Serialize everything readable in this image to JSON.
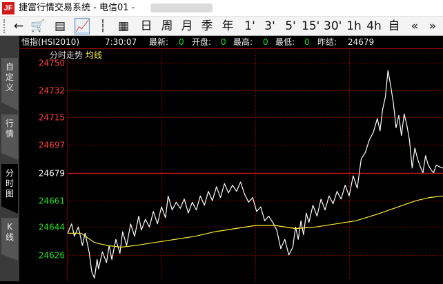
{
  "app": {
    "title": "捷富行情交易系统 - 电信01 -",
    "logo_text": "JF"
  },
  "toolbar": {
    "buttons": [
      {
        "name": "back-icon",
        "glyph": "←"
      },
      {
        "name": "cart-icon",
        "glyph": "🛒"
      },
      {
        "name": "list-icon",
        "glyph": "▤"
      },
      {
        "name": "line-chart-icon",
        "glyph": "📈",
        "active": true
      },
      {
        "name": "candlestick-icon",
        "glyph": "┆"
      },
      {
        "name": "table-icon",
        "glyph": "▦"
      }
    ],
    "periods": [
      "日",
      "周",
      "月",
      "季",
      "年",
      "1'",
      "3'",
      "5'",
      "15'",
      "30'",
      "1h",
      "4h",
      "自"
    ],
    "nav_prev": "«",
    "nav_next": "»"
  },
  "sidetabs": [
    {
      "label": "自定义",
      "active": false
    },
    {
      "label": "行情",
      "active": false
    },
    {
      "label": "分时图",
      "active": true
    },
    {
      "label": "K线",
      "active": false
    }
  ],
  "info": {
    "symbol": "恒指(HSI2010)",
    "time": "7:30:07",
    "latest_label": "最新:",
    "latest_value": "0",
    "open_label": "开盘:",
    "open_value": "0",
    "high_label": "最高:",
    "high_value": "0",
    "low_label": "最低:",
    "low_value": "0",
    "prev_close_label": "昨结:",
    "prev_close_value": "24679"
  },
  "legend": {
    "title": "分时走势",
    "avg_label": "均线"
  },
  "colors": {
    "up": "#ff3c3c",
    "down": "#22dd22",
    "neutral": "#ffffff",
    "grid": "#8b0000",
    "price_line": "#ffffff",
    "avg_line": "#ffee33"
  },
  "chart_data": {
    "type": "line",
    "title": "分时走势",
    "xlabel": "",
    "ylabel": "",
    "prev_close": 24679,
    "y_ticks": [
      24750,
      24732,
      24715,
      24697,
      24679,
      24661,
      24644,
      24626
    ],
    "ylim": [
      24609,
      24750
    ],
    "xlim": [
      0,
      560
    ],
    "grid": true,
    "series": [
      {
        "name": "price",
        "x": [
          0,
          6,
          10,
          16,
          22,
          26,
          32,
          36,
          40,
          44,
          46,
          52,
          58,
          62,
          66,
          72,
          78,
          82,
          88,
          94,
          100,
          106,
          110,
          116,
          122,
          128,
          134,
          140,
          146,
          150,
          156,
          162,
          168,
          174,
          180,
          186,
          192,
          198,
          204,
          210,
          216,
          222,
          228,
          234,
          240,
          246,
          252,
          258,
          264,
          270,
          276,
          282,
          288,
          294,
          300,
          306,
          312,
          318,
          324,
          330,
          336,
          340,
          344,
          348,
          352,
          356,
          360,
          366,
          372,
          378,
          384,
          390,
          396,
          402,
          408,
          414,
          420,
          426,
          432,
          438,
          444,
          450,
          456,
          462,
          466,
          470,
          474,
          478,
          482,
          486,
          490,
          494,
          498,
          502,
          506,
          510,
          514,
          518,
          522,
          526,
          530,
          534,
          538,
          542,
          546,
          550,
          554,
          560
        ],
        "values": [
          24640,
          24646,
          24638,
          24644,
          24632,
          24640,
          24628,
          24615,
          24611,
          24623,
          24617,
          24628,
          24621,
          24632,
          24623,
          24636,
          24627,
          24641,
          24632,
          24646,
          24638,
          24651,
          24642,
          24649,
          24644,
          24654,
          24646,
          24657,
          24650,
          24664,
          24655,
          24660,
          24656,
          24662,
          24653,
          24660,
          24655,
          24664,
          24658,
          24667,
          24661,
          24670,
          24663,
          24672,
          24666,
          24671,
          24667,
          24673,
          24665,
          24660,
          24663,
          24654,
          24657,
          24648,
          24651,
          24647,
          24642,
          24630,
          24636,
          24626,
          24631,
          24644,
          24636,
          24648,
          24639,
          24653,
          24647,
          24658,
          24651,
          24662,
          24655,
          24664,
          24659,
          24667,
          24662,
          24671,
          24664,
          24677,
          24669,
          24688,
          24692,
          24700,
          24705,
          24714,
          24706,
          24720,
          24728,
          24745,
          24735,
          24724,
          24708,
          24716,
          24703,
          24717,
          24710,
          24700,
          24682,
          24695,
          24688,
          24683,
          24679,
          24690,
          24684,
          24681,
          24679,
          24684,
          24683,
          24682
        ]
      },
      {
        "name": "average",
        "x": [
          0,
          20,
          40,
          60,
          80,
          100,
          130,
          160,
          190,
          220,
          250,
          280,
          310,
          340,
          370,
          400,
          430,
          460,
          480,
          500,
          520,
          540,
          560
        ],
        "values": [
          24640,
          24640,
          24634,
          24632,
          24631,
          24632,
          24634,
          24636,
          24638,
          24641,
          24643,
          24645,
          24645,
          24643,
          24644,
          24646,
          24648,
          24652,
          24655,
          24658,
          24661,
          24663,
          24664
        ]
      }
    ]
  }
}
